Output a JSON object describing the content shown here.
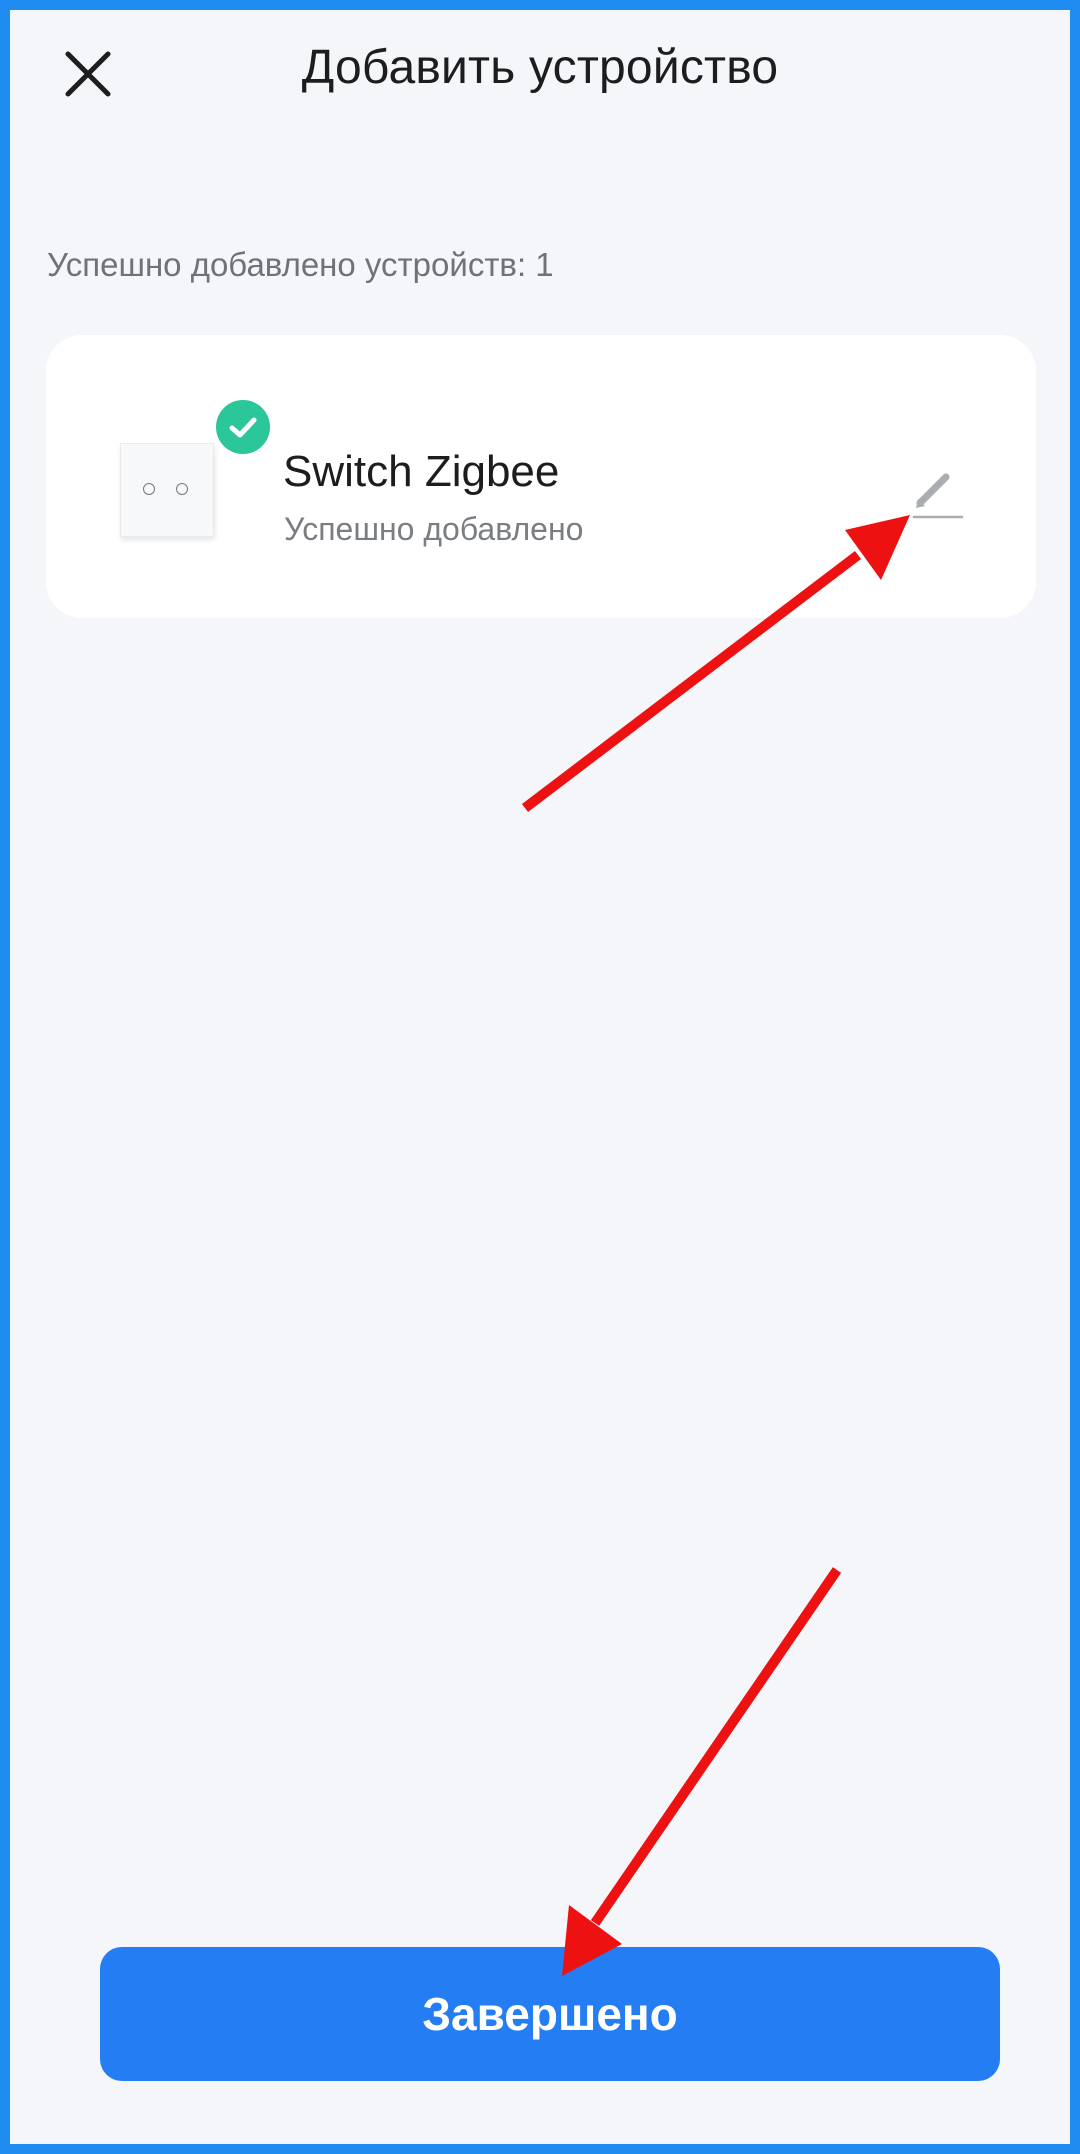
{
  "header": {
    "title": "Добавить устройство",
    "close_icon": "close-icon"
  },
  "summary": {
    "text": "Успешно добавлено устройств: 1"
  },
  "devices": [
    {
      "name": "Switch Zigbee",
      "status": "Успешно добавлено",
      "status_icon": "check-circle-icon",
      "edit_icon": "edit-pencil-icon"
    }
  ],
  "footer": {
    "done_label": "Завершено"
  },
  "colors": {
    "accent": "#247df3",
    "success": "#2cc69b",
    "frame_border": "#1e8cf0",
    "annotation_arrow": "#ee1111",
    "background": "#f4f6fa"
  }
}
